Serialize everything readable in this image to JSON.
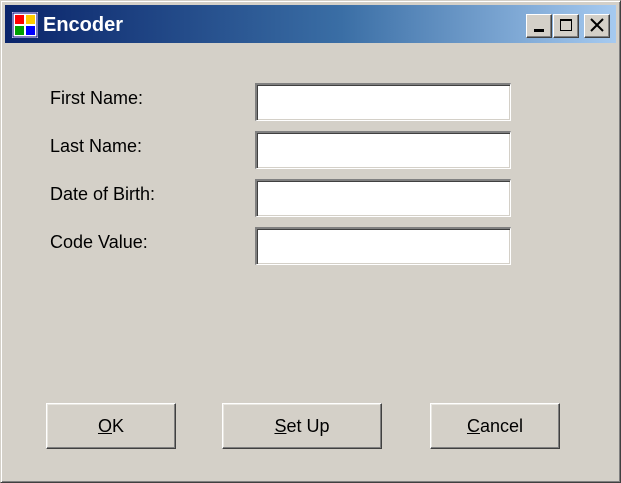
{
  "window": {
    "title": "Encoder",
    "icon": "app-window-icon"
  },
  "caption_buttons": {
    "minimize_icon": "minimize-icon",
    "maximize_icon": "maximize-icon",
    "close_icon": "close-icon"
  },
  "form": {
    "first_name_label": "First Name:",
    "last_name_label": "Last Name:",
    "date_of_birth_label": "Date of Birth:",
    "code_value_label": "Code Value:",
    "first_name_value": "",
    "last_name_value": "",
    "date_of_birth_value": "",
    "code_value_value": ""
  },
  "buttons": {
    "ok": {
      "access_key": "O",
      "rest": "K"
    },
    "setup": {
      "access_key": "S",
      "rest": "et Up"
    },
    "cancel": {
      "access_key": "C",
      "rest": "ancel"
    }
  },
  "colors": {
    "titlebar_start": "#0a246a",
    "titlebar_end": "#a6caf0",
    "face": "#d4d0c8"
  }
}
